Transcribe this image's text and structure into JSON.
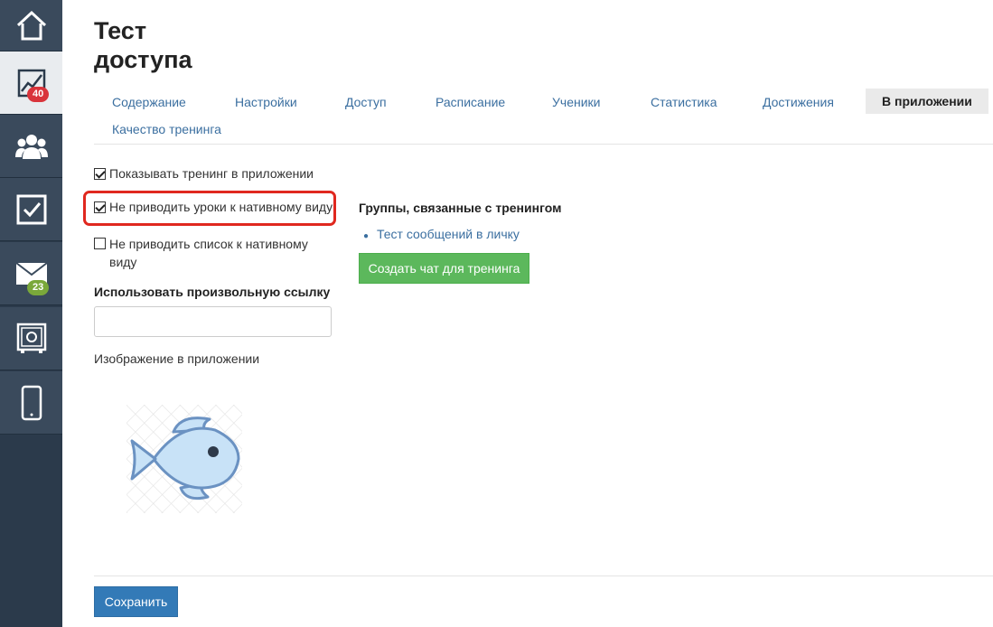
{
  "sidebar": {
    "items": [
      {
        "icon": "home-icon"
      },
      {
        "icon": "chart-icon",
        "badge": "40"
      },
      {
        "icon": "users-icon"
      },
      {
        "icon": "tasks-icon"
      },
      {
        "icon": "mail-icon",
        "badge": "23"
      },
      {
        "icon": "safe-icon"
      },
      {
        "icon": "phone-icon"
      }
    ]
  },
  "page": {
    "title_line1": "Тест",
    "title_line2": "доступа"
  },
  "tabs": [
    {
      "label": "Содержание"
    },
    {
      "label": "Настройки"
    },
    {
      "label": "Доступ"
    },
    {
      "label": "Расписание"
    },
    {
      "label": "Ученики"
    },
    {
      "label": "Статистика"
    },
    {
      "label": "Достижения"
    },
    {
      "label": "В приложении",
      "active": true
    },
    {
      "label": "Качество тренинга"
    }
  ],
  "settings": {
    "show_in_app": {
      "label": "Показывать тренинг в приложении",
      "checked": true
    },
    "no_native_lessons": {
      "label": "Не приводить уроки к нативному виду",
      "checked": true
    },
    "no_native_list_line1": "Не приводить список к нативному",
    "no_native_list_line2": "виду",
    "no_native_list_checked": false,
    "custom_link_label": "Использовать произвольную ссылку",
    "custom_link_value": "",
    "image_label": "Изображение в приложении"
  },
  "groups": {
    "heading": "Группы, связанные с тренингом",
    "items": [
      "Тест сообщений в личку"
    ],
    "create_chat_button": "Создать чат для тренинга"
  },
  "footer": {
    "save_button": "Сохранить"
  },
  "colors": {
    "sidebar": "#2b3a4b",
    "link": "#3b6fa0",
    "highlight": "#e0281f",
    "green_button": "#5cb85c",
    "blue_button": "#337ab7"
  }
}
